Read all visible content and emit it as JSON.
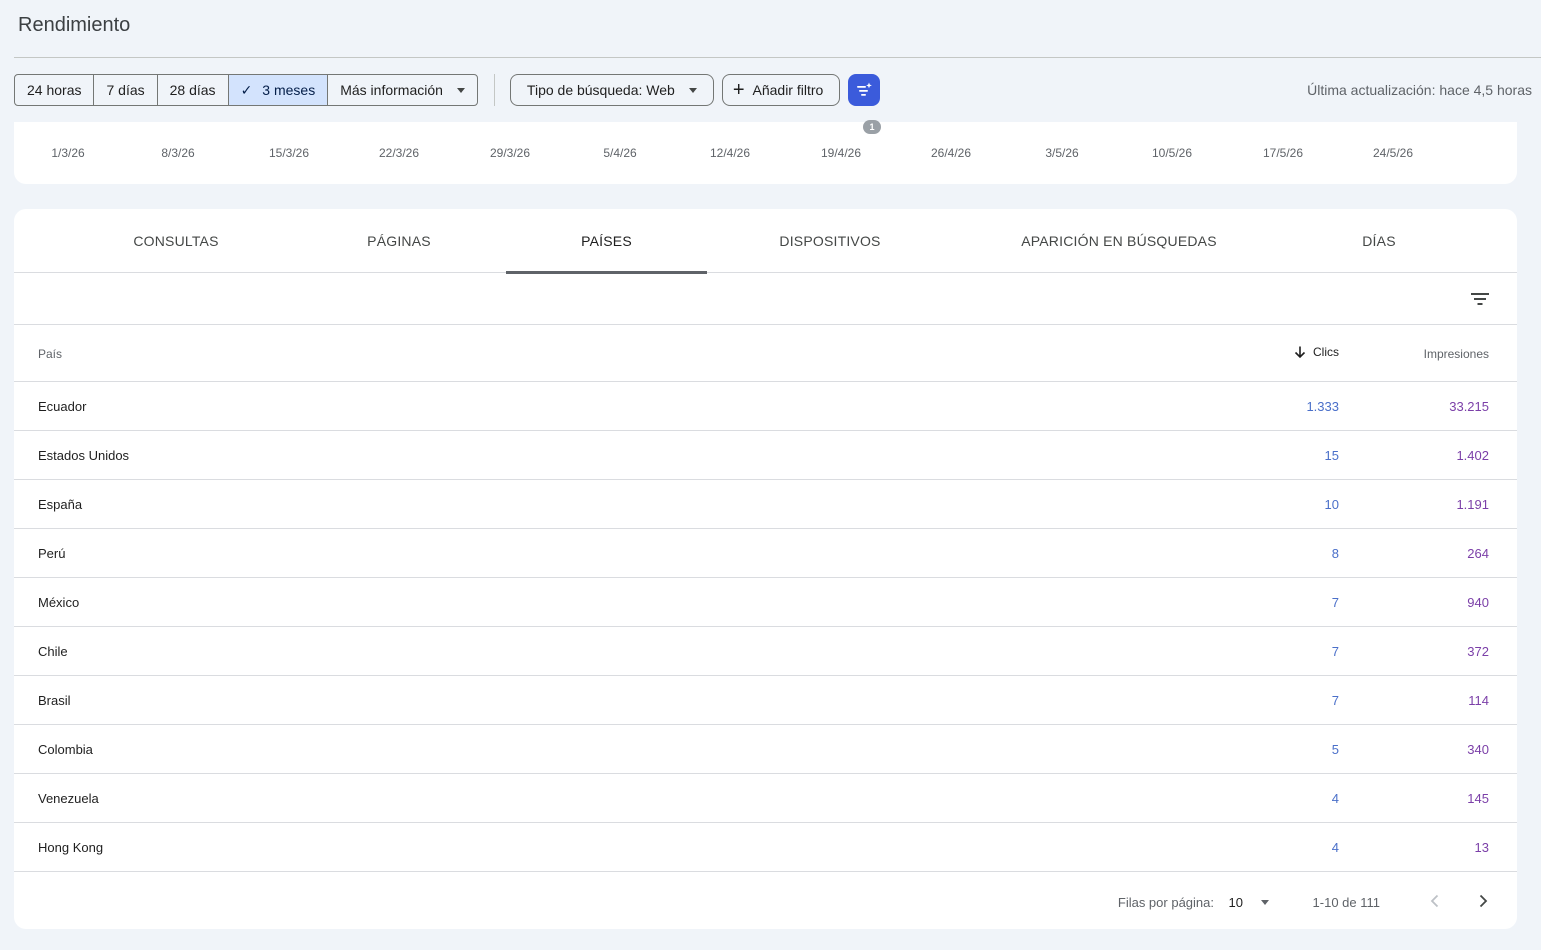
{
  "page": {
    "title": "Rendimiento",
    "last_update": "Última actualización: hace 4,5 horas"
  },
  "date_range": {
    "options": [
      "24 horas",
      "7 días",
      "28 días",
      "3 meses"
    ],
    "selected": "3 meses",
    "more_label": "Más información"
  },
  "filters": {
    "search_type_label": "Tipo de búsqueda: Web",
    "add_filter_label": "Añadir filtro",
    "compare_icon": "filter-sparkle-icon"
  },
  "chart": {
    "x_ticks": [
      "1/3/26",
      "8/3/26",
      "15/3/26",
      "22/3/26",
      "29/3/26",
      "5/4/26",
      "12/4/26",
      "19/4/26",
      "26/4/26",
      "3/5/26",
      "10/5/26",
      "17/5/26",
      "24/5/26"
    ],
    "annotation_badge": "1"
  },
  "tabs": [
    {
      "label": "CONSULTAS",
      "active": false
    },
    {
      "label": "PÁGINAS",
      "active": false
    },
    {
      "label": "PAÍSES",
      "active": true
    },
    {
      "label": "DISPOSITIVOS",
      "active": false
    },
    {
      "label": "APARICIÓN EN BÚSQUEDAS",
      "active": false
    },
    {
      "label": "DÍAS",
      "active": false
    }
  ],
  "table": {
    "columns": {
      "country": "País",
      "clicks": "Clics",
      "impressions": "Impresiones"
    },
    "sort_icon": "arrow-down-icon",
    "rows": [
      {
        "country": "Ecuador",
        "clicks": "1.333",
        "impressions": "33.215"
      },
      {
        "country": "Estados Unidos",
        "clicks": "15",
        "impressions": "1.402"
      },
      {
        "country": "España",
        "clicks": "10",
        "impressions": "1.191"
      },
      {
        "country": "Perú",
        "clicks": "8",
        "impressions": "264"
      },
      {
        "country": "México",
        "clicks": "7",
        "impressions": "940"
      },
      {
        "country": "Chile",
        "clicks": "7",
        "impressions": "372"
      },
      {
        "country": "Brasil",
        "clicks": "7",
        "impressions": "114"
      },
      {
        "country": "Colombia",
        "clicks": "5",
        "impressions": "340"
      },
      {
        "country": "Venezuela",
        "clicks": "4",
        "impressions": "145"
      },
      {
        "country": "Hong Kong",
        "clicks": "4",
        "impressions": "13"
      }
    ]
  },
  "pagination": {
    "rows_per_page_label": "Filas por página:",
    "rows_per_page": "10",
    "range": "1-10 de 111"
  },
  "colors": {
    "clicks": "#4a6fc9",
    "impressions": "#7b3fa8",
    "selected_range": "#d3e3fd",
    "accent_button": "#3b5bdb"
  }
}
